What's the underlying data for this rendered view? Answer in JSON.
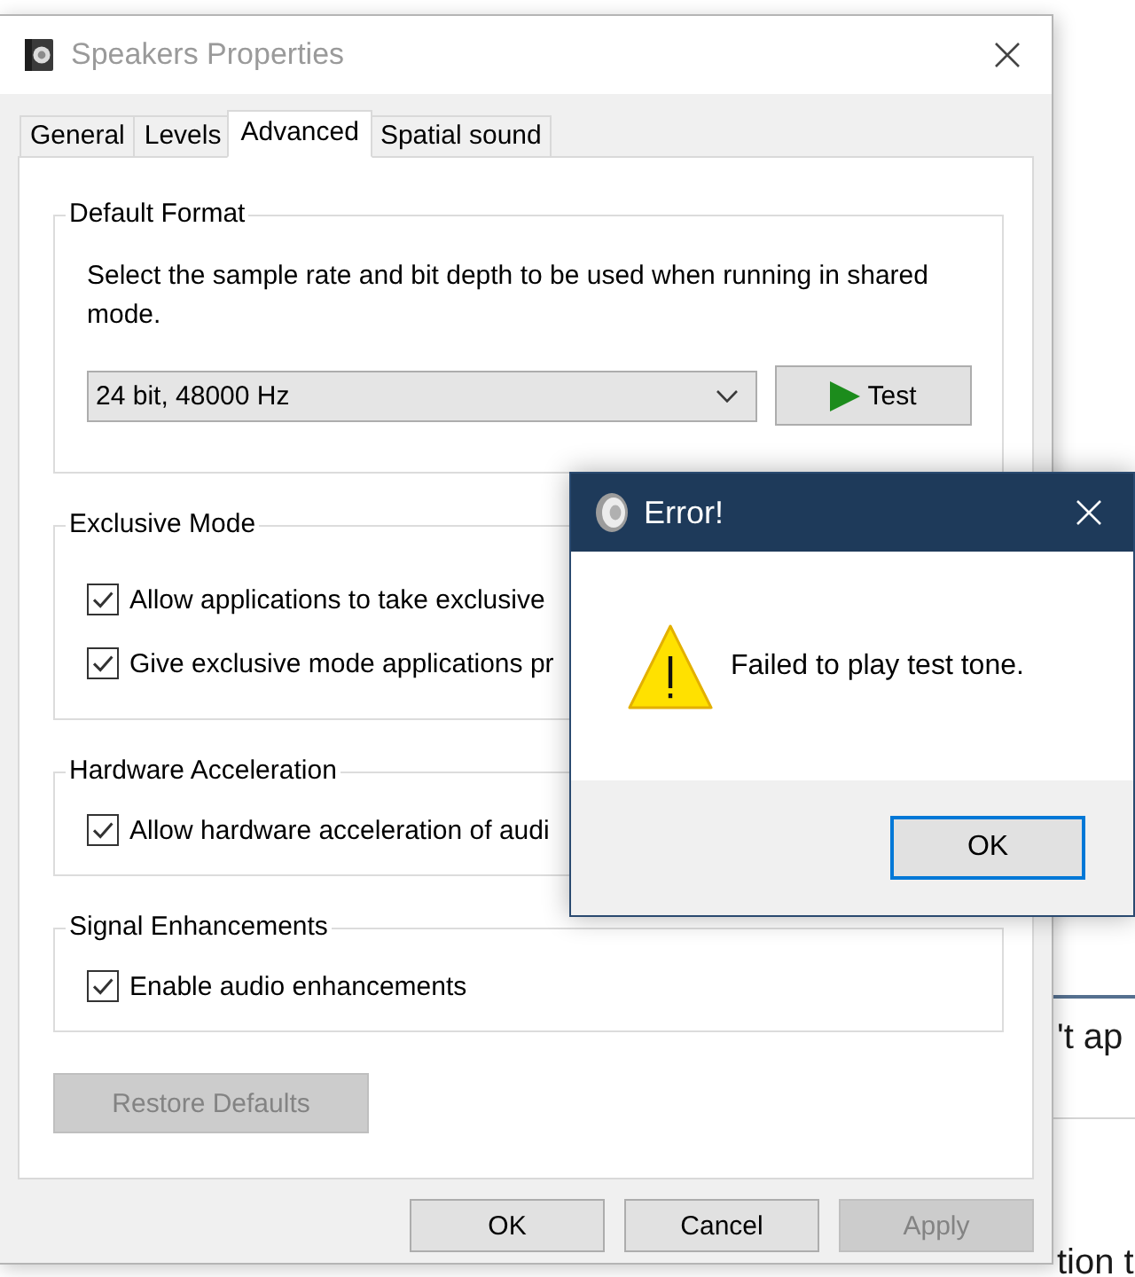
{
  "background_page": {
    "texts": [
      "'t ap",
      "tion t"
    ]
  },
  "properties_window": {
    "title": "Speakers Properties",
    "active": false,
    "tabs": [
      {
        "label": "General",
        "selected": false
      },
      {
        "label": "Levels",
        "selected": false
      },
      {
        "label": "Advanced",
        "selected": true
      },
      {
        "label": "Spatial sound",
        "selected": false
      }
    ],
    "groups": [
      {
        "kind": "format",
        "title": "Default Format",
        "description": "Select the sample rate and bit depth to be used when running in shared mode.",
        "format_select": {
          "value": "24 bit, 48000 Hz"
        },
        "test_button": "Test"
      },
      {
        "kind": "checkboxes",
        "title": "Exclusive Mode",
        "options": [
          {
            "label": "Allow applications to take exclusive",
            "checked": true
          },
          {
            "label": "Give exclusive mode applications pr",
            "checked": true
          }
        ]
      },
      {
        "kind": "checkboxes",
        "title": "Hardware Acceleration",
        "options": [
          {
            "label": "Allow hardware acceleration of audi",
            "checked": true
          }
        ]
      },
      {
        "kind": "checkboxes",
        "title": "Signal Enhancements",
        "options": [
          {
            "label": "Enable audio enhancements",
            "checked": true
          }
        ]
      }
    ],
    "restore_button": {
      "label": "Restore Defaults",
      "disabled": true
    },
    "buttons": [
      {
        "label": "OK",
        "disabled": false
      },
      {
        "label": "Cancel",
        "disabled": false
      },
      {
        "label": "Apply",
        "disabled": true
      }
    ]
  },
  "error_dialog": {
    "title": "Error!",
    "active": true,
    "message": "Failed to play test tone.",
    "buttons": [
      {
        "label": "OK",
        "default": true
      }
    ]
  }
}
